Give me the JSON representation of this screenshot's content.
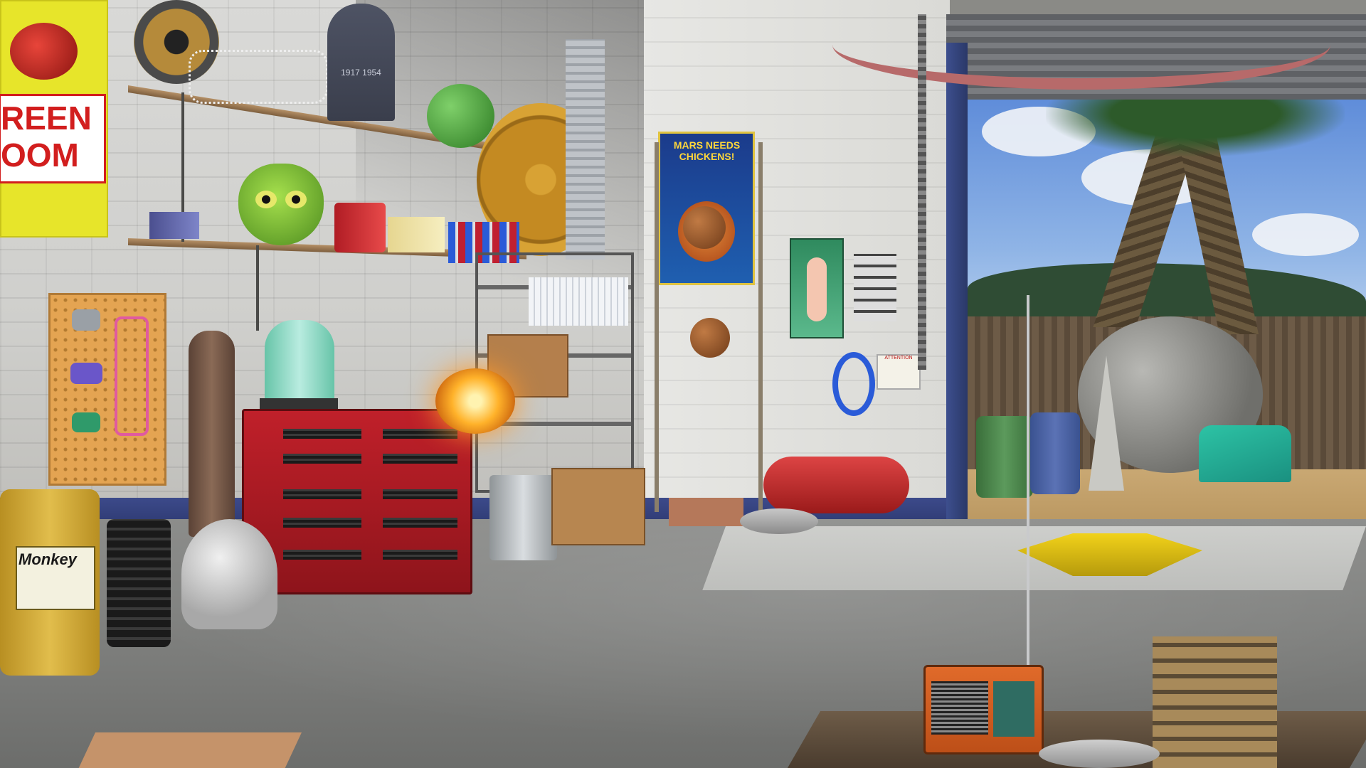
{
  "scene": {
    "setting": "garage",
    "outdoor_view": "yard"
  },
  "posters": {
    "left_poster_line1": "REEN",
    "left_poster_line2": "OOM",
    "mars_poster_title": "MARS NEEDS CHICKENS!",
    "attention_sign": "ATTENTION",
    "tombstone_text": "1917 1954"
  },
  "barrel": {
    "label": "Monkey"
  },
  "colors": {
    "toolchest": "#b01c24",
    "wall": "#d6d6d3",
    "sky": "#6b96dd",
    "floor": "#858684"
  },
  "icons": {
    "plaque": "round-plaque-icon",
    "skeleton": "skeleton-icon",
    "alien_head": "alien-head-icon",
    "orb": "glowing-orb-icon",
    "radio": "radio-icon",
    "rocket": "rocket-icon"
  }
}
